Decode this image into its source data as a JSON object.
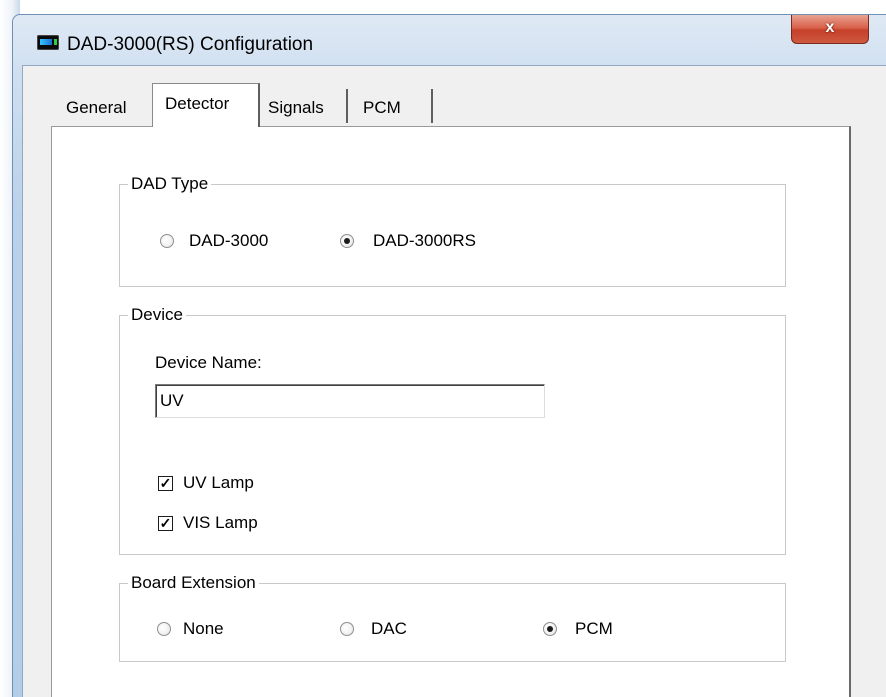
{
  "window": {
    "title": "DAD-3000(RS) Configuration",
    "close_label": "x"
  },
  "tabs": [
    {
      "label": "General",
      "selected": false
    },
    {
      "label": "Detector",
      "selected": true
    },
    {
      "label": "Signals",
      "selected": false
    },
    {
      "label": "PCM",
      "selected": false
    }
  ],
  "dad_type": {
    "title": "DAD Type",
    "options": [
      {
        "label": "DAD-3000",
        "checked": false
      },
      {
        "label": "DAD-3000RS",
        "checked": true
      }
    ]
  },
  "device": {
    "title": "Device",
    "name_label": "Device Name:",
    "name_value": "UV",
    "uv_lamp": {
      "label": "UV Lamp",
      "checked": true
    },
    "vis_lamp": {
      "label": "VIS Lamp",
      "checked": true
    }
  },
  "board_extension": {
    "title": "Board Extension",
    "options": [
      {
        "label": "None",
        "checked": false
      },
      {
        "label": "DAC",
        "checked": false
      },
      {
        "label": "PCM",
        "checked": true
      }
    ]
  }
}
